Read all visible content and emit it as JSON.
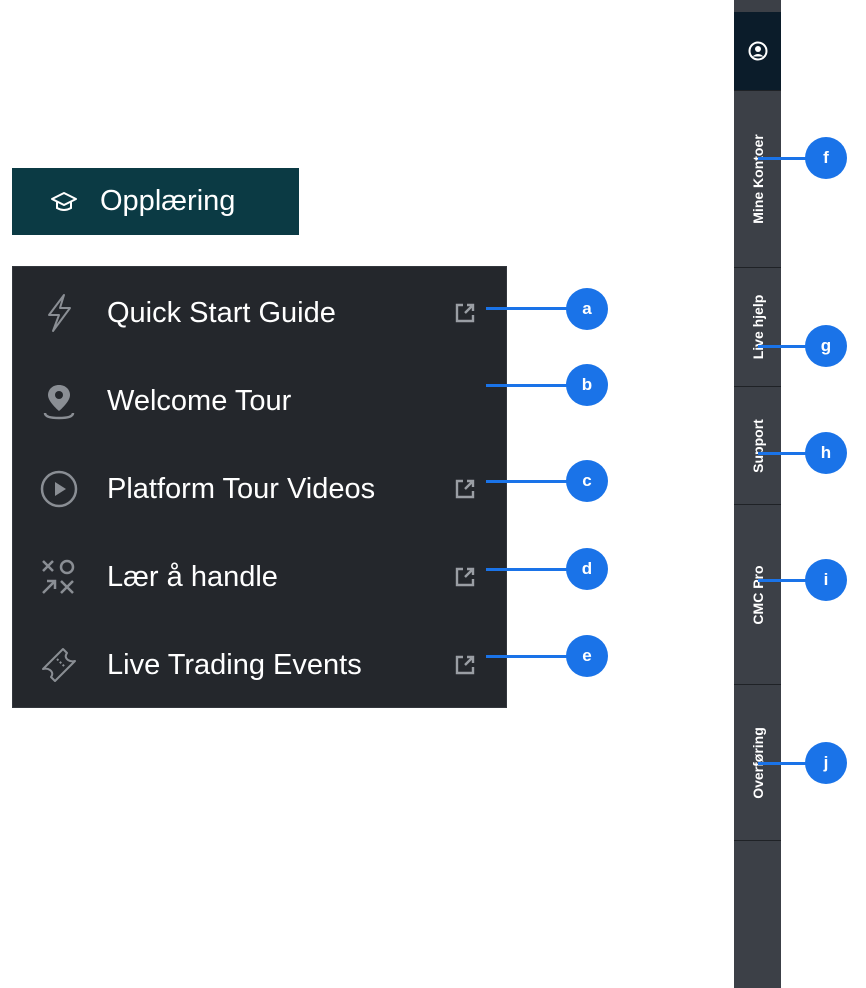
{
  "menu": {
    "header_label": "Opplæring",
    "items": [
      {
        "label": "Quick Start Guide",
        "icon": "bolt-icon",
        "external": true,
        "callout": "a"
      },
      {
        "label": "Welcome Tour",
        "icon": "location-pin-icon",
        "external": false,
        "callout": "b"
      },
      {
        "label": "Platform Tour Videos",
        "icon": "play-circle-icon",
        "external": true,
        "callout": "c"
      },
      {
        "label": "Lær å handle",
        "icon": "strategy-icon",
        "external": true,
        "callout": "d"
      },
      {
        "label": "Live Trading Events",
        "icon": "ticket-icon",
        "external": true,
        "callout": "e"
      }
    ]
  },
  "sidebar": {
    "top_icon": "user-account-icon",
    "tabs": [
      {
        "label": "Mine Kontoer",
        "callout": "f"
      },
      {
        "label": "Live hjelp",
        "callout": "g"
      },
      {
        "label": "Support",
        "callout": "h"
      },
      {
        "label": "CMC Pro",
        "callout": "i"
      },
      {
        "label": "Overføring",
        "callout": "j"
      }
    ]
  },
  "colors": {
    "header_bg": "#0b3a44",
    "panel_bg": "#24272c",
    "sidebar_bg": "#3c4047",
    "sidebar_top_bg": "#0b1c2a",
    "callout_blue": "#1a73e8",
    "icon_gray": "#8a8e94"
  }
}
